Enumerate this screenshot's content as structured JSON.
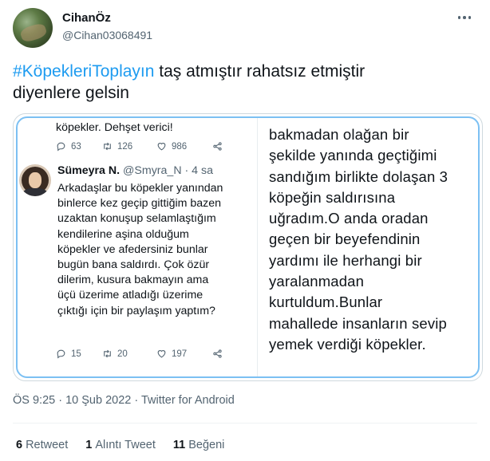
{
  "author": {
    "display_name": "CihanÖz",
    "handle": "@Cihan03068491"
  },
  "tweet": {
    "hashtag": "#KöpekleriToplayın",
    "text_line1_rest": " taş atmıştır rahatsız etmiştir",
    "text_line2": "diyenlere gelsin"
  },
  "media": {
    "top_tweet": {
      "text_tail": "köpekler. Dehşet verici!",
      "replies": "63",
      "retweets": "126",
      "likes": "986"
    },
    "quoted_tweet": {
      "name": "Sümeyra N.",
      "handle": "@Smyra_N",
      "separator": " · ",
      "time": "4 sa",
      "lines": [
        "Arkadaşlar bu köpekler yanından",
        "binlerce kez geçip gittiğim bazen",
        "uzaktan konuşup selamlaştığım",
        "kendilerine aşina olduğum",
        "köpekler ve afedersiniz bunlar",
        "bugün bana saldırdı. Çok özür",
        "dilerim, kusura bakmayın ama",
        "üçü üzerime atladığı üzerime",
        "çıktığı için bir paylaşım yaptım?"
      ],
      "replies": "15",
      "retweets": "20",
      "likes": "197"
    },
    "right_text_lines": [
      "bakmadan olağan bir",
      "şekilde yanında geçtiğimi",
      "sandığım birlikte dolaşan 3",
      "köpeğin saldırısına",
      "uğradım.O anda oradan",
      "geçen bir beyefendinin",
      "yardımı ile herhangi bir",
      "yaralanmadan",
      "kurtuldum.Bunlar",
      "mahallede insanların sevip",
      "yemek verdiği köpekler."
    ]
  },
  "meta": {
    "timestamp": "ÖS 9:25 · 10 Şub 2022 · Twitter for Android"
  },
  "stats": {
    "retweets_count": "6",
    "retweets_label": "Retweet",
    "quotes_count": "1",
    "quotes_label": "Alıntı Tweet",
    "likes_count": "11",
    "likes_label": "Beğeni"
  },
  "colors": {
    "accent": "#1d9bf0",
    "secondary_text": "#536471",
    "highlight_border": "#7cc0f3"
  },
  "icons": [
    "more-icon",
    "reply-icon",
    "retweet-icon",
    "like-icon",
    "share-icon"
  ]
}
